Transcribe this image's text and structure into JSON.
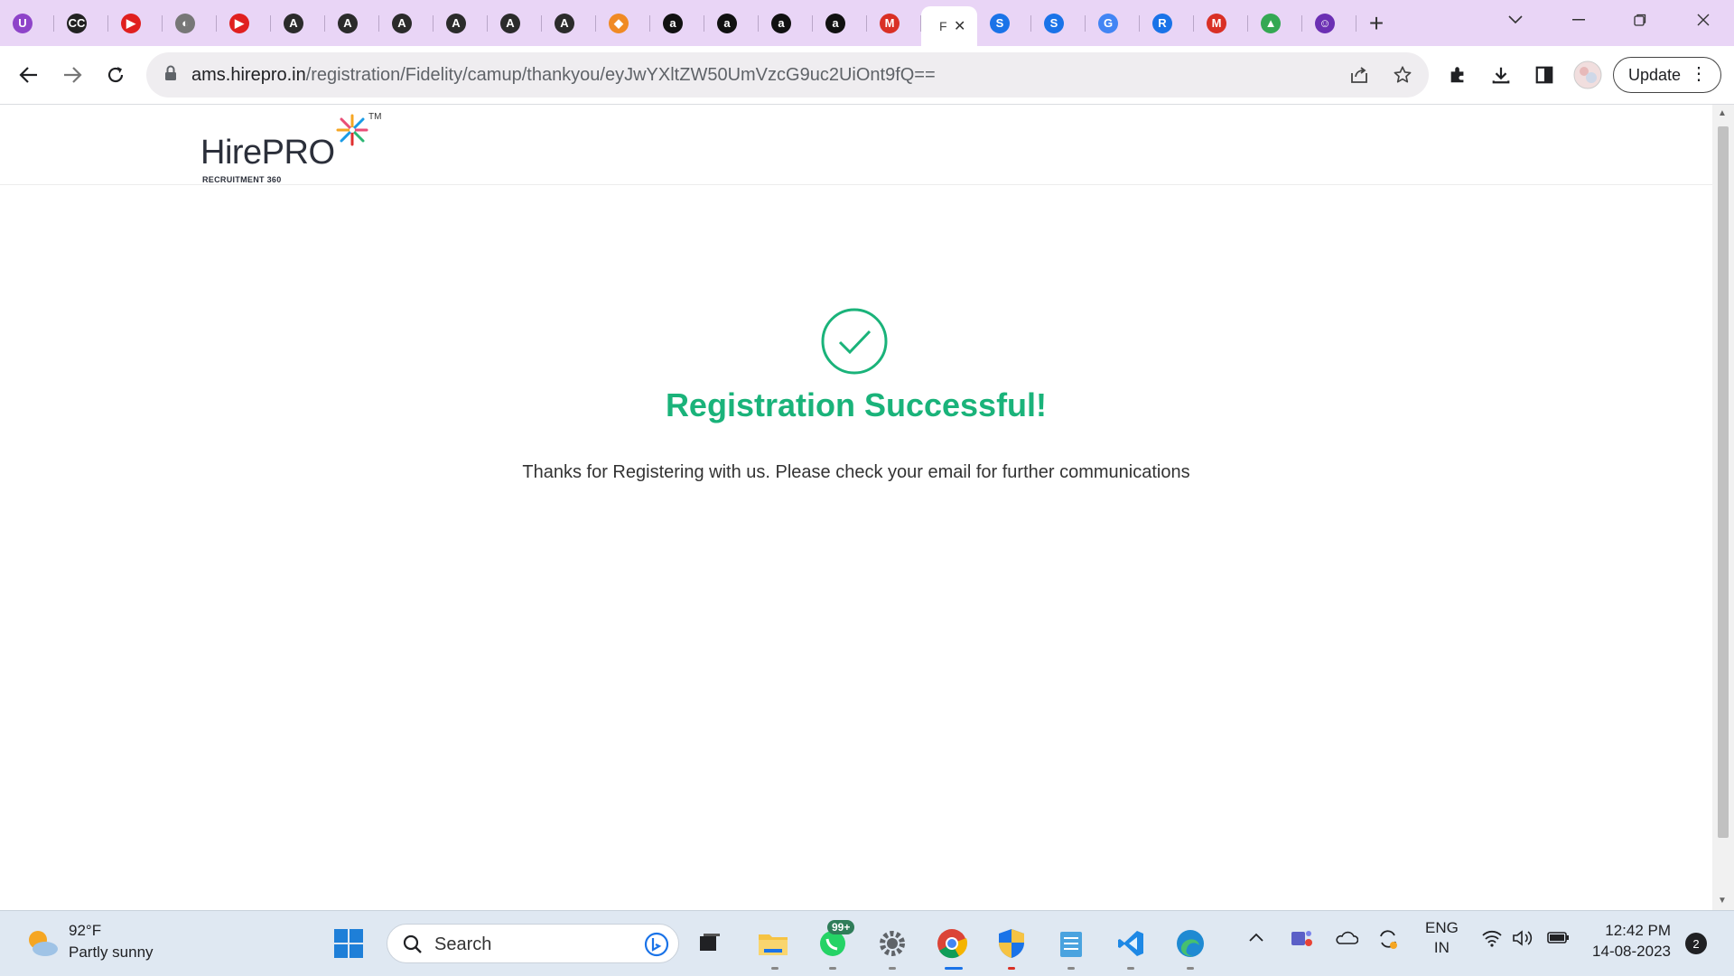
{
  "browser": {
    "tabs": [
      {
        "name": "tab-1",
        "glyph": "U",
        "color": "#8e44c9"
      },
      {
        "name": "tab-2",
        "glyph": "CC",
        "color": "#222222"
      },
      {
        "name": "tab-3",
        "glyph": "▶",
        "color": "#e0201f"
      },
      {
        "name": "tab-4",
        "glyph": "◐",
        "color": "#777777"
      },
      {
        "name": "tab-5",
        "glyph": "▶",
        "color": "#e0201f"
      },
      {
        "name": "tab-6",
        "glyph": "A",
        "color": "#2b2b2b"
      },
      {
        "name": "tab-7",
        "glyph": "A",
        "color": "#2b2b2b"
      },
      {
        "name": "tab-8",
        "glyph": "A",
        "color": "#2b2b2b"
      },
      {
        "name": "tab-9",
        "glyph": "A",
        "color": "#2b2b2b"
      },
      {
        "name": "tab-10",
        "glyph": "A",
        "color": "#2b2b2b"
      },
      {
        "name": "tab-11",
        "glyph": "A",
        "color": "#2b2b2b"
      },
      {
        "name": "tab-12",
        "glyph": "◆",
        "color": "#f08a24"
      },
      {
        "name": "tab-13",
        "glyph": "a",
        "color": "#111111"
      },
      {
        "name": "tab-14",
        "glyph": "a",
        "color": "#111111"
      },
      {
        "name": "tab-15",
        "glyph": "a",
        "color": "#111111"
      },
      {
        "name": "tab-16",
        "glyph": "a",
        "color": "#111111"
      },
      {
        "name": "tab-17",
        "glyph": "M",
        "color": "#d93025"
      }
    ],
    "active_tab": {
      "caption": "F",
      "close": "✕"
    },
    "tabs_after": [
      {
        "name": "tab-19",
        "glyph": "S",
        "color": "#1a73e8"
      },
      {
        "name": "tab-20",
        "glyph": "S",
        "color": "#1a73e8"
      },
      {
        "name": "tab-21",
        "glyph": "G",
        "color": "#4285f4"
      },
      {
        "name": "tab-22",
        "glyph": "R",
        "color": "#1a73e8"
      },
      {
        "name": "tab-23",
        "glyph": "M",
        "color": "#d93025"
      },
      {
        "name": "tab-24",
        "glyph": "▲",
        "color": "#34a853"
      },
      {
        "name": "tab-25",
        "glyph": "☺",
        "color": "#6b2fb3"
      }
    ],
    "url_host": "ams.hirepro.in",
    "url_path": "/registration/Fidelity/camup/thankyou/eyJwYXltZW50UmVzcG9uc2UiOnt9fQ==",
    "update_label": "Update"
  },
  "page": {
    "logo_word": "HirePRO",
    "logo_sub": "RECRUITMENT 360",
    "logo_tm": "TM",
    "title": "Registration Successful!",
    "message": "Thanks for Registering with us. Please check your email for further communications",
    "accent_color": "#1ab37a"
  },
  "taskbar": {
    "weather_temp": "92°F",
    "weather_cond": "Partly sunny",
    "search_label": "Search",
    "whatsapp_badge": "99+",
    "lang_1": "ENG",
    "lang_2": "IN",
    "time": "12:42 PM",
    "date": "14-08-2023",
    "notif_count": "2"
  }
}
